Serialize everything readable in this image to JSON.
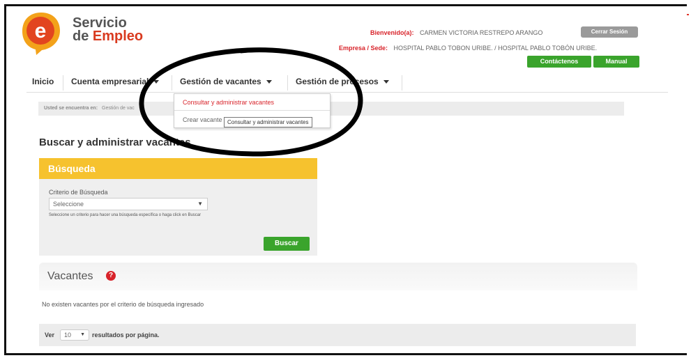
{
  "brand": {
    "line1": "Servicio",
    "de": "de ",
    "empleo": "Empleo",
    "logo_letter": "e"
  },
  "header": {
    "welcome_label": "Bienvenido(a):",
    "welcome_value": "CARMEN VICTORIA RESTREPO ARANGO",
    "logout_label": "Cerrar Sesión",
    "empresa_label": "Empresa / Sede:",
    "empresa_value": "HOSPITAL PABLO TOBON URIBE. / HOSPITAL PABLO TOBÓN URIBE.",
    "contact_label": "Contáctenos",
    "manual_label": "Manual"
  },
  "nav": {
    "items": [
      {
        "label": "Inicio"
      },
      {
        "label": "Cuenta empresarial"
      },
      {
        "label": "Gestión de vacantes"
      },
      {
        "label": "Gestión de procesos"
      }
    ]
  },
  "breadcrumb": {
    "label": "Usted se encuentra en:",
    "path": "Gestión de vac"
  },
  "menu": {
    "items": [
      {
        "label": "Consultar y administrar vacantes"
      },
      {
        "label": "Crear vacante"
      }
    ],
    "tooltip": "Consultar y administrar vacantes"
  },
  "page": {
    "title": "Buscar y administrar vacantes"
  },
  "search": {
    "header": "Búsqueda",
    "criteria_label": "Criterio de Búsqueda",
    "criteria_value": "Seleccione",
    "hint": "Seleccione un criterio para hacer una búsqueda específica o haga click en Buscar",
    "button": "Buscar"
  },
  "results": {
    "title": "Vacantes",
    "help_icon": "?",
    "empty_text": "No existen vacantes por el criterio de búsqueda ingresado",
    "ver_label": "Ver",
    "page_size": "10",
    "page_size_suffix": "resultados por página."
  },
  "colors": {
    "brand_red": "#d8232a",
    "brand_yellow": "#f6c22e",
    "brand_green": "#3aa42c"
  }
}
